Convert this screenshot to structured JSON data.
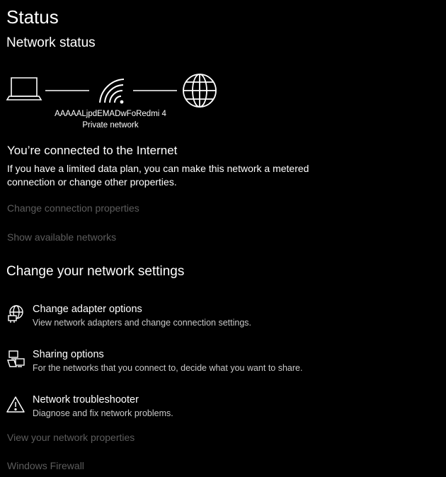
{
  "page": {
    "title": "Status",
    "section_title": "Network status"
  },
  "diagram": {
    "network_name": "AAAAALjpdEMADwFoRedmi 4",
    "network_type": "Private network",
    "icons": [
      "laptop-icon",
      "wifi-icon",
      "globe-icon"
    ]
  },
  "connection": {
    "heading": "You’re connected to the Internet",
    "description": "If you have a limited data plan, you can make this network a metered connection or change other properties."
  },
  "links": {
    "change_connection_properties": "Change connection properties",
    "show_available_networks": "Show available networks",
    "view_network_properties": "View your network properties",
    "windows_firewall": "Windows Firewall"
  },
  "settings": {
    "heading": "Change your network settings",
    "items": [
      {
        "icon": "network-adapter-icon",
        "title": "Change adapter options",
        "description": "View network adapters and change connection settings."
      },
      {
        "icon": "sharing-icon",
        "title": "Sharing options",
        "description": "For the networks that you connect to, decide what you want to share."
      },
      {
        "icon": "warning-icon",
        "title": "Network troubleshooter",
        "description": "Diagnose and fix network problems."
      }
    ]
  },
  "colors": {
    "background": "#000000",
    "text": "#ffffff",
    "secondary_text": "#c8c8c8",
    "disabled_link": "#5d5d5d"
  }
}
